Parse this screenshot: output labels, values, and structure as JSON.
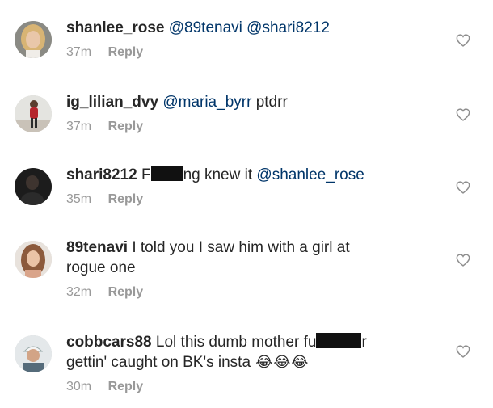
{
  "comments": [
    {
      "username": "shanlee_rose",
      "mentions": [
        "@89tenavi",
        "@shari8212"
      ],
      "time": "37m",
      "reply": "Reply",
      "avatar_icon": "profile-photo-blonde",
      "heart_icon": "heart-outline-icon"
    },
    {
      "username": "ig_lilian_dvy",
      "mention": "@maria_byrr",
      "text_after": "ptdrr",
      "time": "37m",
      "reply": "Reply",
      "avatar_icon": "profile-photo-red-outfit",
      "heart_icon": "heart-outline-icon"
    },
    {
      "username": "shari8212",
      "text_before": "F",
      "text_after": "ng knew it",
      "mention": "@shanlee_rose",
      "time": "35m",
      "reply": "Reply",
      "avatar_icon": "profile-photo-dark",
      "heart_icon": "heart-outline-icon"
    },
    {
      "username": "89tenavi",
      "text_line1": "I told you I saw him with a girl at",
      "text_line2": "rogue one",
      "time": "32m",
      "reply": "Reply",
      "avatar_icon": "profile-photo-woman",
      "heart_icon": "heart-outline-icon"
    },
    {
      "username": "cobbcars88",
      "text_line1a": "Lol this dumb mother fu",
      "text_line1b": "r",
      "text_line2": "gettin' caught on BK's insta",
      "emoji": [
        "😂",
        "😂",
        "😂"
      ],
      "time": "30m",
      "reply": "Reply",
      "avatar_icon": "profile-photo-cap",
      "heart_icon": "heart-outline-icon"
    }
  ],
  "colors": {
    "text": "#262626",
    "mention": "#003569",
    "meta": "#999999",
    "heart": "#8e8e8e"
  }
}
